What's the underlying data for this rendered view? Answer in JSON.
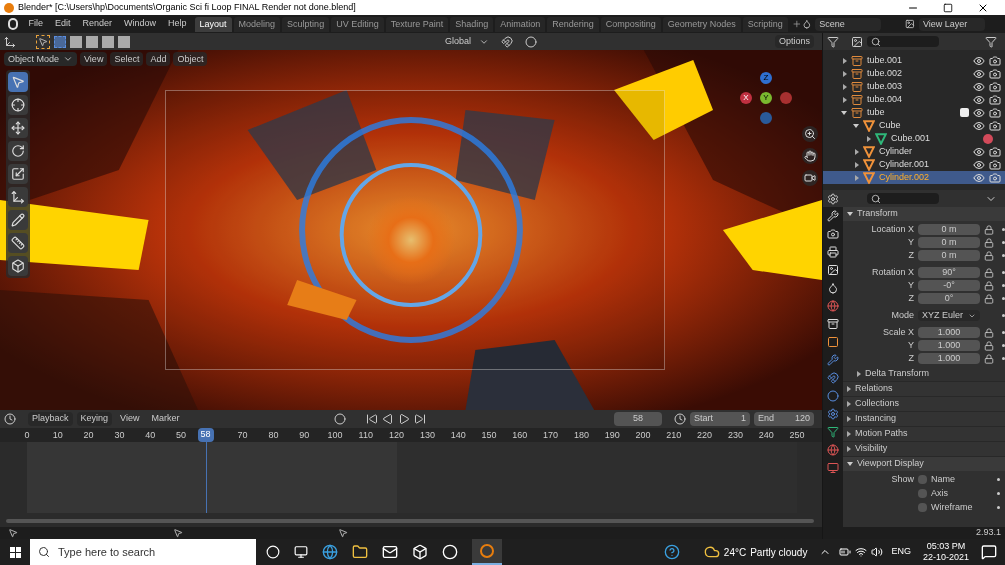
{
  "window": {
    "title": "Blender* [C:\\Users\\hp\\Documents\\Organic Sci fi Loop FINAL Render not done.blend]"
  },
  "menu": [
    "File",
    "Edit",
    "Render",
    "Window",
    "Help"
  ],
  "workspaces": [
    {
      "label": "Layout",
      "selected": true
    },
    {
      "label": "Modeling",
      "selected": false
    },
    {
      "label": "Sculpting",
      "selected": false
    },
    {
      "label": "UV Editing",
      "selected": false
    },
    {
      "label": "Texture Paint",
      "selected": false
    },
    {
      "label": "Shading",
      "selected": false
    },
    {
      "label": "Animation",
      "selected": false
    },
    {
      "label": "Rendering",
      "selected": false
    },
    {
      "label": "Compositing",
      "selected": false
    },
    {
      "label": "Geometry Nodes",
      "selected": false
    },
    {
      "label": "Scripting",
      "selected": false
    }
  ],
  "scene": "Scene",
  "view_layer": "View Layer",
  "tool_header": {
    "orientation": "Global",
    "options": "Options"
  },
  "viewport": {
    "mode": "Object Mode",
    "menus": [
      "View",
      "Select",
      "Add",
      "Object"
    ],
    "axes": [
      "Z",
      "X",
      "Y"
    ]
  },
  "outliner": [
    {
      "name": "tube.001",
      "kind": "collection",
      "expanded": false,
      "selected": false
    },
    {
      "name": "tube.002",
      "kind": "collection",
      "expanded": false,
      "selected": false
    },
    {
      "name": "tube.003",
      "kind": "collection",
      "expanded": false,
      "selected": false
    },
    {
      "name": "tube.004",
      "kind": "collection",
      "expanded": false,
      "selected": false
    },
    {
      "name": "tube",
      "kind": "collection",
      "expanded": true,
      "selected": false,
      "checked": true,
      "children": [
        {
          "name": "Cube",
          "kind": "object",
          "expanded": true,
          "selected": false,
          "children": [
            {
              "name": "Cube.001",
              "kind": "mesh",
              "expanded": false,
              "selected": false
            }
          ]
        },
        {
          "name": "Cylinder",
          "kind": "object",
          "expanded": false,
          "selected": false
        },
        {
          "name": "Cylinder.001",
          "kind": "object",
          "expanded": false,
          "selected": false
        },
        {
          "name": "Cylinder.002",
          "kind": "object",
          "expanded": false,
          "selected": true
        }
      ]
    }
  ],
  "properties": {
    "panel": "Transform",
    "rows": [
      {
        "kind": "number",
        "label": "Location X",
        "value": "0 m"
      },
      {
        "kind": "number",
        "label": "Y",
        "value": "0 m"
      },
      {
        "kind": "number",
        "label": "Z",
        "value": "0 m"
      },
      {
        "kind": "number",
        "label": "Rotation X",
        "value": "90°"
      },
      {
        "kind": "number",
        "label": "Y",
        "value": "-0°"
      },
      {
        "kind": "number",
        "label": "Z",
        "value": "0°"
      },
      {
        "kind": "select",
        "label": "Mode",
        "value": "XYZ Euler"
      },
      {
        "kind": "number",
        "label": "Scale X",
        "value": "1.000"
      },
      {
        "kind": "number",
        "label": "Y",
        "value": "1.000"
      },
      {
        "kind": "number",
        "label": "Z",
        "value": "1.000"
      }
    ],
    "subpanel": "Delta Transform",
    "sections": [
      {
        "label": "Relations",
        "expanded": false
      },
      {
        "label": "Collections",
        "expanded": false
      },
      {
        "label": "Instancing",
        "expanded": false
      },
      {
        "label": "Motion Paths",
        "expanded": false
      },
      {
        "label": "Visibility",
        "expanded": false
      },
      {
        "label": "Viewport Display",
        "expanded": true
      }
    ],
    "show": {
      "label": "Show",
      "options": [
        {
          "label": "Name",
          "checked": false
        },
        {
          "label": "Axis",
          "checked": false
        },
        {
          "label": "Wireframe",
          "checked": false
        }
      ]
    }
  },
  "version": "2.93.1",
  "timeline": {
    "menus": [
      "Playback",
      "Keying",
      "View",
      "Marker"
    ],
    "current_frame": "58",
    "start_label": "Start",
    "start": "1",
    "end_label": "End",
    "end": "120",
    "ticks": [
      "0",
      "10",
      "20",
      "30",
      "40",
      "50",
      "70",
      "80",
      "90",
      "100",
      "110",
      "120",
      "130",
      "140",
      "150",
      "160",
      "170",
      "180",
      "190",
      "200",
      "210",
      "220",
      "230",
      "240",
      "250"
    ],
    "playhead": {
      "label": "58",
      "level": 0.232
    },
    "range": {
      "level": 0.48
    }
  },
  "taskbar": {
    "search_placeholder": "Type here to search",
    "temperature": "24°C",
    "weather": "Partly cloudy",
    "language": "ENG",
    "time": "05:03 PM",
    "date": "22-10-2021"
  }
}
